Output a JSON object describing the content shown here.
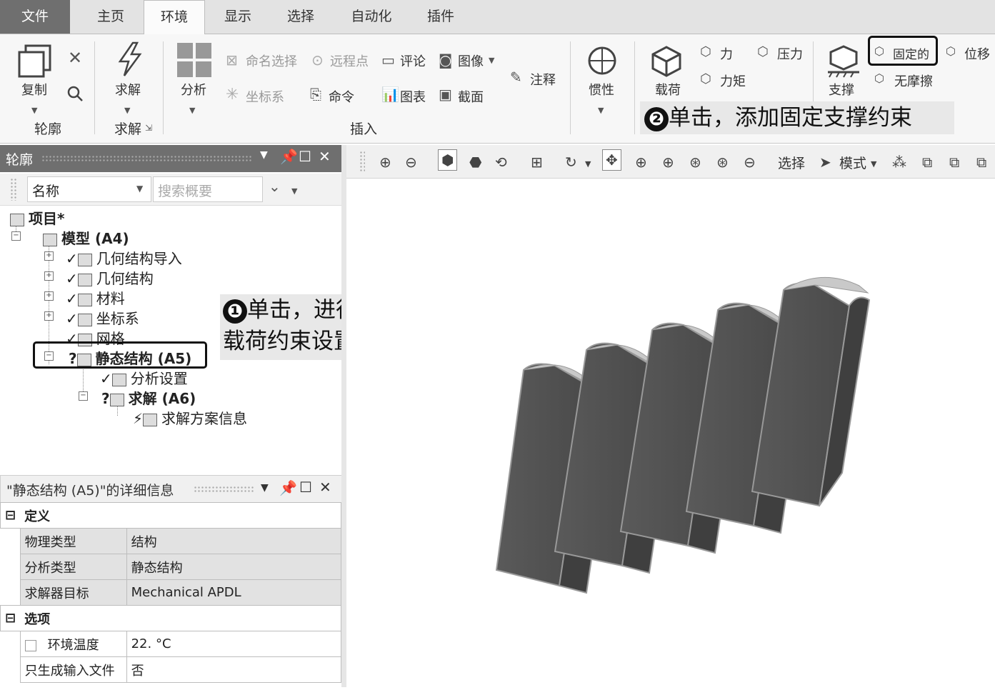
{
  "tabs": [
    "文件",
    "主页",
    "环境",
    "显示",
    "选择",
    "自动化",
    "插件"
  ],
  "ribbon": {
    "outline_group": {
      "copy": "复制",
      "label": "轮廓"
    },
    "solve_group": {
      "solve": "求解",
      "label": "求解"
    },
    "insert_group": {
      "analysis": "分析",
      "named_selection": "命名选择",
      "remote_point": "远程点",
      "comment": "评论",
      "image": "图像",
      "coordinate_system": "坐标系",
      "command": "命令",
      "chart": "图表",
      "section": "截面",
      "annotation": "注释",
      "label": "插入"
    },
    "inertia": "惯性",
    "loads": {
      "label": "载荷",
      "force": "力",
      "moment": "力矩",
      "pressure": "压力"
    },
    "supports": {
      "label": "支撑",
      "fixed": "固定的",
      "displacement": "位移",
      "frictionless": "无摩擦"
    }
  },
  "callouts": {
    "one_num": "❶",
    "one_line1": "单击，进行",
    "one_line2": "载荷约束设置",
    "two_num": "❷",
    "two_text": "单击，添加固定支撑约束"
  },
  "outline": {
    "title": "轮廓",
    "filter_label": "名称",
    "search_placeholder": "搜索概要",
    "tree": {
      "project": "项目*",
      "model": "模型 (A4)",
      "geometry_import": "几何结构导入",
      "geometry": "几何结构",
      "materials": "材料",
      "coords": "坐标系",
      "mesh": "网格",
      "static": "静态结构 (A5)",
      "analysis_settings": "分析设置",
      "solution": "求解 (A6)",
      "solution_info": "求解方案信息"
    }
  },
  "details": {
    "title": "\"静态结构 (A5)\"的详细信息",
    "sections": {
      "definition": "定义",
      "options": "选项"
    },
    "rows": [
      {
        "k": "物理类型",
        "v": "结构"
      },
      {
        "k": "分析类型",
        "v": "静态结构"
      },
      {
        "k": "求解器目标",
        "v": "Mechanical APDL"
      },
      {
        "k": "环境温度",
        "v": "22. °C"
      },
      {
        "k": "只生成输入文件",
        "v": "否"
      }
    ]
  },
  "viewer_toolbar": {
    "select": "选择",
    "mode": "模式"
  }
}
